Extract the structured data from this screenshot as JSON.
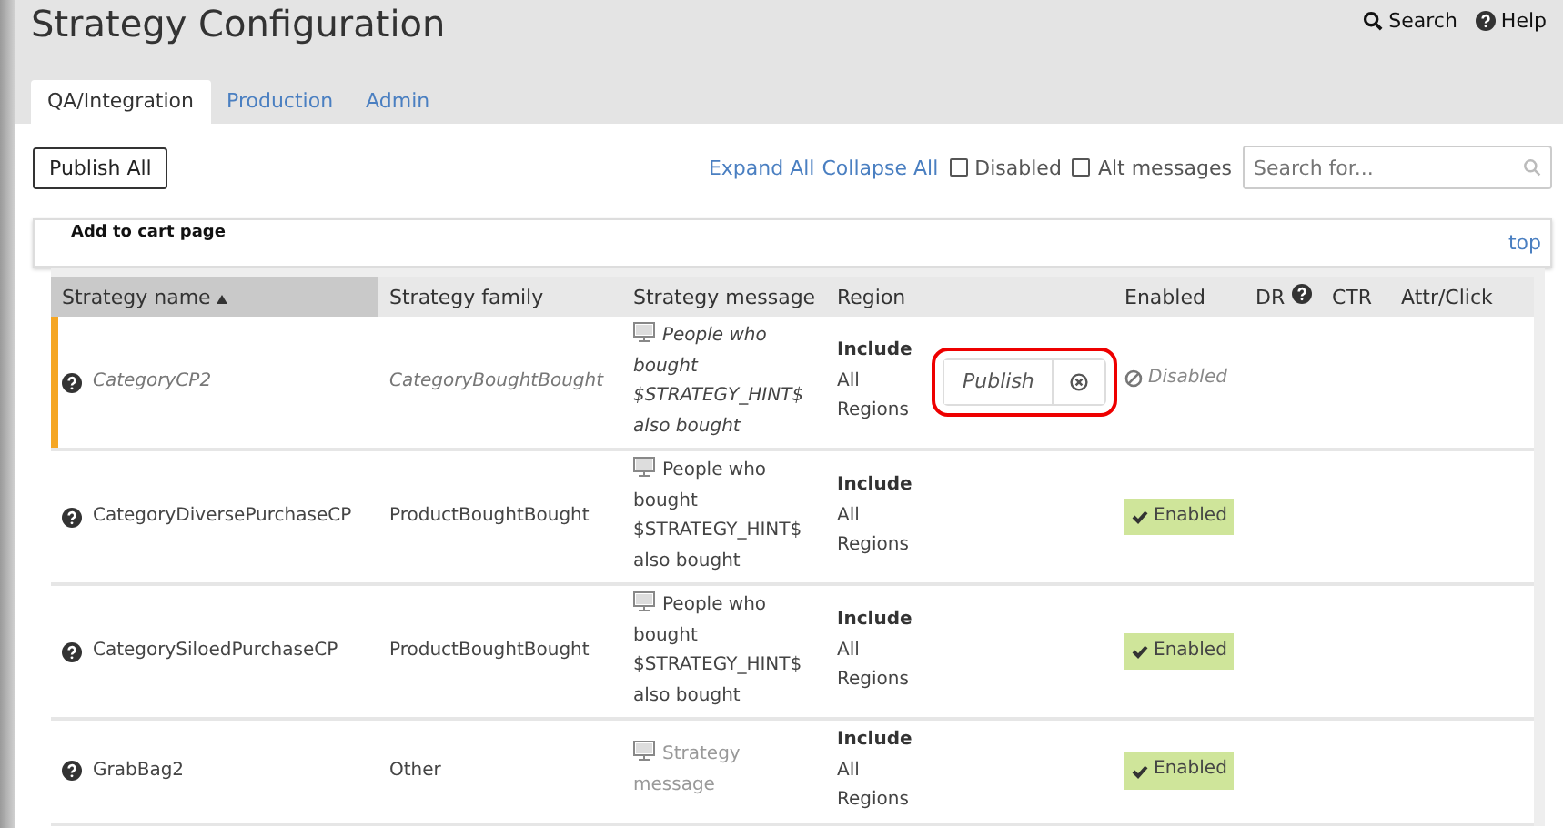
{
  "header": {
    "title": "Strategy Configuration",
    "links": [
      {
        "kind": "search",
        "label": "Search"
      },
      {
        "kind": "help",
        "label": "Help"
      }
    ]
  },
  "tabs": [
    {
      "label": "QA/Integration",
      "selected": true
    },
    {
      "label": "Production",
      "selected": false
    },
    {
      "label": "Admin",
      "selected": false
    }
  ],
  "toolbar": {
    "publish_all": "Publish All",
    "expand_all": "Expand All",
    "collapse_all": "Collapse All",
    "filters": [
      {
        "label": "Disabled",
        "checked": false
      },
      {
        "label": "Alt messages",
        "checked": false
      }
    ],
    "search": {
      "placeholder": "Search for..."
    }
  },
  "section": {
    "title": "Add to cart page",
    "top_link": "top"
  },
  "table": {
    "columns": [
      {
        "label": "Strategy name",
        "sorted": true,
        "help": false
      },
      {
        "label": "Strategy family",
        "sorted": false,
        "help": false
      },
      {
        "label": "Strategy message",
        "sorted": false,
        "help": false
      },
      {
        "label": "Region",
        "sorted": false,
        "help": false
      },
      {
        "label": "Enabled",
        "sorted": false,
        "help": false
      },
      {
        "label": "DR",
        "sorted": false,
        "help": true
      },
      {
        "label": "CTR",
        "sorted": false,
        "help": false
      },
      {
        "label": "Attr/Click",
        "sorted": false,
        "help": false
      }
    ],
    "rows": [
      {
        "name": "CategoryCP2",
        "family": "CategoryBoughtBought",
        "message": "People who bought $STRATEGY_HINT$ also bought",
        "message_is_placeholder": false,
        "region_mode": "Include",
        "region": "All Regions",
        "enabled": false,
        "status": "Disabled",
        "pending": true,
        "publish": {
          "label": "Publish",
          "highlighted": true
        }
      },
      {
        "name": "CategoryDiversePurchaseCP",
        "family": "ProductBoughtBought",
        "message": "People who bought $STRATEGY_HINT$ also bought",
        "message_is_placeholder": false,
        "region_mode": "Include",
        "region": "All Regions",
        "enabled": true,
        "status": "Enabled",
        "pending": false
      },
      {
        "name": "CategorySiloedPurchaseCP",
        "family": "ProductBoughtBought",
        "message": "People who bought $STRATEGY_HINT$ also bought",
        "message_is_placeholder": false,
        "region_mode": "Include",
        "region": "All Regions",
        "enabled": true,
        "status": "Enabled",
        "pending": false
      },
      {
        "name": "GrabBag2",
        "family": "Other",
        "message": "Strategy message",
        "message_is_placeholder": true,
        "region_mode": "Include",
        "region": "All Regions",
        "enabled": true,
        "status": "Enabled",
        "pending": false
      }
    ]
  }
}
